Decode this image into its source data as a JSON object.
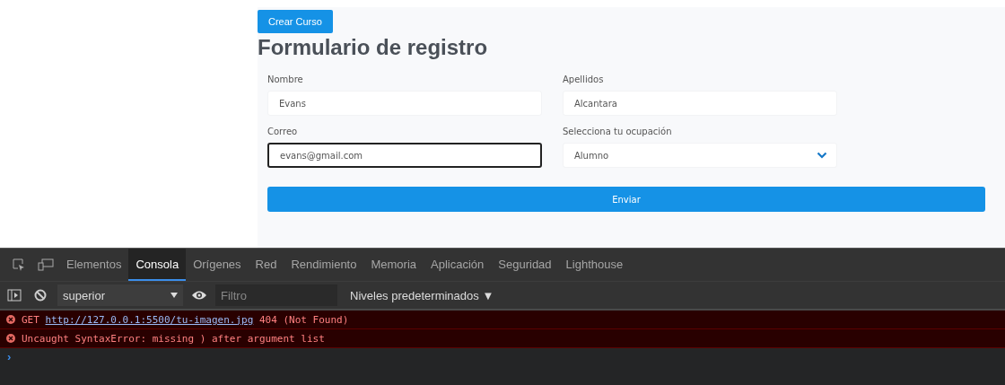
{
  "page": {
    "create_button": "Crear Curso",
    "title": "Formulario de registro",
    "fields": [
      {
        "label": "Nombre",
        "value": "Evans",
        "kind": "text",
        "focused": false
      },
      {
        "label": "Apellidos",
        "value": "Alcantara",
        "kind": "text",
        "focused": false
      },
      {
        "label": "Correo",
        "value": "evans@gmail.com",
        "kind": "text",
        "focused": true
      },
      {
        "label": "Selecciona tu ocupación",
        "value": "Alumno",
        "kind": "select",
        "focused": false
      }
    ],
    "submit": "Enviar"
  },
  "devtools": {
    "tabs": [
      {
        "label": "Elementos",
        "selected": false
      },
      {
        "label": "Consola",
        "selected": true
      },
      {
        "label": "Orígenes",
        "selected": false
      },
      {
        "label": "Red",
        "selected": false
      },
      {
        "label": "Rendimiento",
        "selected": false
      },
      {
        "label": "Memoria",
        "selected": false
      },
      {
        "label": "Aplicación",
        "selected": false
      },
      {
        "label": "Seguridad",
        "selected": false
      },
      {
        "label": "Lighthouse",
        "selected": false
      }
    ],
    "context": "superior",
    "filter": {
      "placeholder": "Filtro"
    },
    "levels": "Niveles predeterminados ▼",
    "messages": [
      {
        "kind": "error",
        "parts": [
          "GET ",
          {
            "link": "http://127.0.0.1:5500/tu-imagen.jpg"
          },
          " 404 (Not Found)"
        ]
      },
      {
        "kind": "error",
        "parts": [
          "Uncaught SyntaxError: missing ) after argument list"
        ]
      }
    ],
    "prompt": "›"
  }
}
